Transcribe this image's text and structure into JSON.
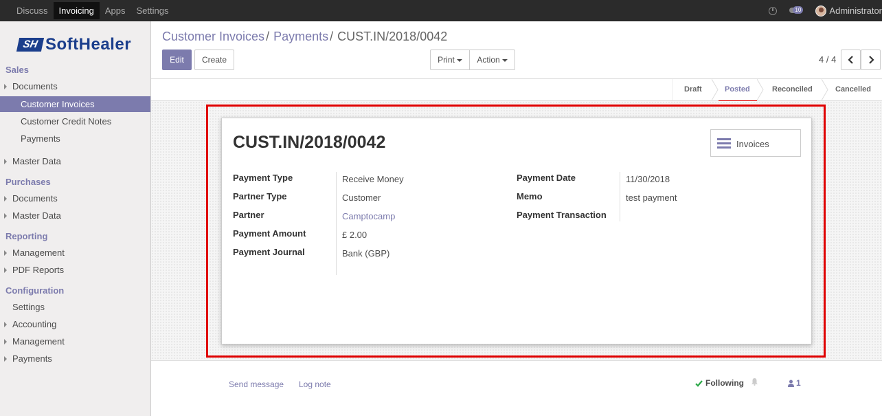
{
  "topbar": {
    "menu": [
      "Discuss",
      "Invoicing",
      "Apps",
      "Settings"
    ],
    "active_menu": "Invoicing",
    "message_count": "10",
    "user": "Administrator"
  },
  "sidebar": {
    "logo_mark": "SH",
    "logo_text": "SoftHealer",
    "sections": [
      {
        "title": "Sales",
        "items": [
          "Documents",
          "Customer Invoices",
          "Customer Credit Notes",
          "Payments",
          "Master Data"
        ]
      },
      {
        "title": "Purchases",
        "items": [
          "Documents",
          "Master Data"
        ]
      },
      {
        "title": "Reporting",
        "items": [
          "Management",
          "PDF Reports"
        ]
      },
      {
        "title": "Configuration",
        "items": [
          "Settings",
          "Accounting",
          "Management",
          "Payments"
        ]
      }
    ],
    "active_item": "Customer Invoices"
  },
  "breadcrumb": {
    "items": [
      "Customer Invoices",
      "Payments"
    ],
    "current": "CUST.IN/2018/0042",
    "separator": "/"
  },
  "buttons": {
    "edit": "Edit",
    "create": "Create",
    "print": "Print",
    "action": "Action"
  },
  "pager": {
    "value": "4 / 4"
  },
  "statusbar": {
    "states": [
      "Draft",
      "Posted",
      "Reconciled",
      "Cancelled"
    ],
    "active": "Posted"
  },
  "record": {
    "title": "CUST.IN/2018/0042",
    "smart_button": "Invoices",
    "left_fields": [
      {
        "label": "Payment Type",
        "value": "Receive Money"
      },
      {
        "label": "Partner Type",
        "value": "Customer"
      },
      {
        "label": "Partner",
        "value": "Camptocamp"
      },
      {
        "label": "Payment Amount",
        "value": "£ 2.00"
      },
      {
        "label": "Payment Journal",
        "value": "Bank (GBP)"
      }
    ],
    "right_fields": [
      {
        "label": "Payment Date",
        "value": "11/30/2018"
      },
      {
        "label": "Memo",
        "value": "test payment"
      },
      {
        "label": "Payment Transaction",
        "value": ""
      }
    ]
  },
  "chatter": {
    "send_message": "Send message",
    "log_note": "Log note",
    "following": "Following",
    "followers_count": "1"
  },
  "colors": {
    "accent": "#7c7bad",
    "highlight": "#e00000",
    "topbar": "#2b2b2b"
  }
}
